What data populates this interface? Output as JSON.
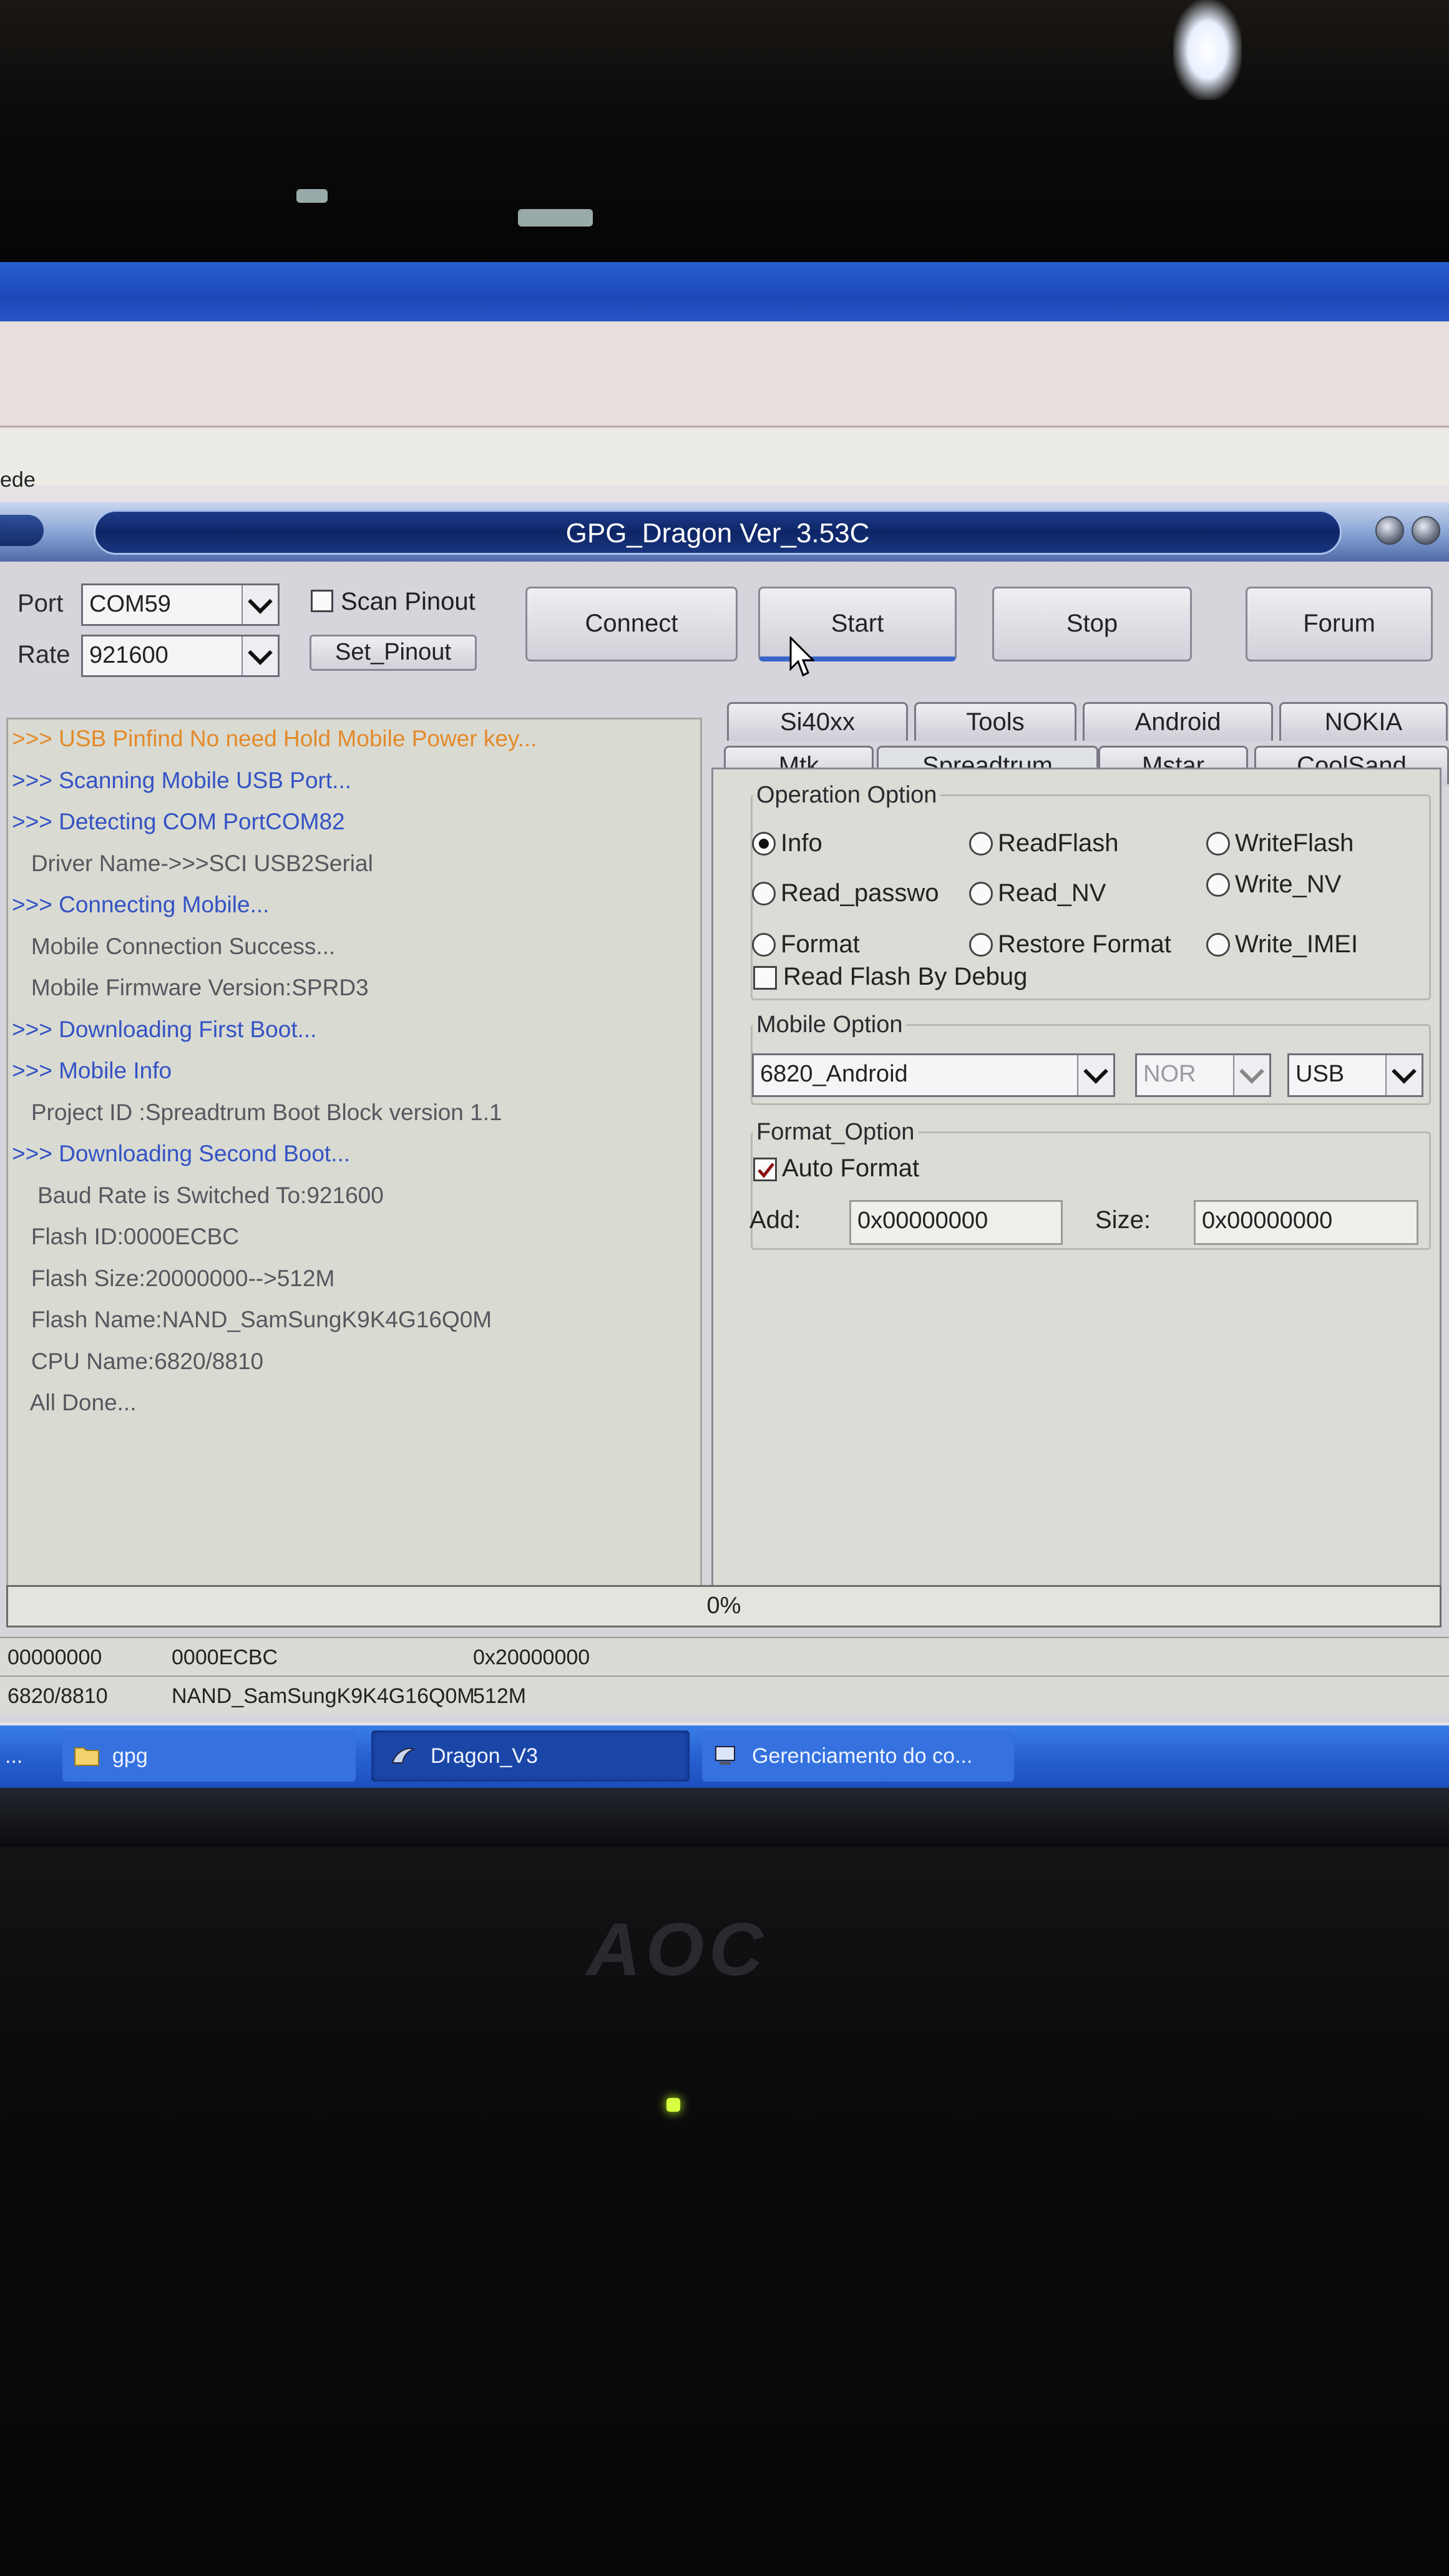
{
  "app": {
    "title": "GPG_Dragon  Ver_3.53C"
  },
  "background_window": {
    "label": "ede"
  },
  "connection": {
    "port_label": "Port",
    "port_value": "COM59",
    "rate_label": "Rate",
    "rate_value": "921600",
    "scan_pinout_label": "Scan Pinout",
    "set_pinout_label": "Set_Pinout"
  },
  "actions": {
    "connect": "Connect",
    "start": "Start",
    "stop": "Stop",
    "forum": "Forum"
  },
  "log": [
    {
      "text": ">>> USB Pinfind No need Hold Mobile Power key...",
      "color": "orange"
    },
    {
      "text": ">>> Scanning Mobile USB Port...",
      "color": "blue"
    },
    {
      "text": ">>> Detecting COM PortCOM82",
      "color": "blue"
    },
    {
      "text": "   Driver Name->>>SCI USB2Serial",
      "color": "gray"
    },
    {
      "text": ">>> Connecting Mobile...",
      "color": "blue"
    },
    {
      "text": "   Mobile Connection Success...",
      "color": "gray"
    },
    {
      "text": "   Mobile Firmware Version:SPRD3",
      "color": "gray"
    },
    {
      "text": ">>> Downloading First Boot...",
      "color": "blue"
    },
    {
      "text": ">>> Mobile Info",
      "color": "blue"
    },
    {
      "text": "   Project ID :Spreadtrum Boot Block version 1.1",
      "color": "gray"
    },
    {
      "text": ">>> Downloading Second Boot...",
      "color": "blue"
    },
    {
      "text": "    Baud Rate is Switched To:921600",
      "color": "gray"
    },
    {
      "text": "   Flash ID:0000ECBC",
      "color": "gray"
    },
    {
      "text": "   Flash Size:20000000-->512M",
      "color": "gray"
    },
    {
      "text": "   Flash Name:NAND_SamSungK9K4G16Q0M",
      "color": "gray"
    },
    {
      "text": "   CPU Name:6820/8810",
      "color": "gray"
    },
    {
      "text": "   All Done...",
      "color": "gray"
    }
  ],
  "tabs": {
    "row1": [
      "Si40xx",
      "Tools",
      "Android",
      "NOKIA"
    ],
    "row2": [
      "Mtk",
      "Spreadtrum",
      "Mstar",
      "CoolSand"
    ],
    "active": "Spreadtrum"
  },
  "operation_option": {
    "title": "Operation Option",
    "options": [
      "Info",
      "ReadFlash",
      "WriteFlash",
      "Read_passwo",
      "Read_NV",
      "Write_NV",
      "Format",
      "Restore Format",
      "Write_IMEI"
    ],
    "selected": "Info",
    "read_flash_by_debug": "Read Flash By Debug"
  },
  "mobile_option": {
    "title": "Mobile Option",
    "model": "6820_Android",
    "flash_type": "NOR",
    "interface": "USB"
  },
  "format_option": {
    "title": "Format_Option",
    "auto_format_label": "Auto Format",
    "auto_format_checked": true,
    "add_label": "Add:",
    "add_value": "0x00000000",
    "size_label": "Size:",
    "size_value": "0x00000000"
  },
  "progress": {
    "text": "0%",
    "value": 0
  },
  "status": {
    "row1": [
      "00000000",
      "0000ECBC",
      "0x20000000"
    ],
    "row2": [
      "6820/8810",
      "NAND_SamSungK9K4G16Q0M",
      "512M"
    ]
  },
  "taskbar": {
    "items": [
      "...",
      "gpg",
      "Dragon_V3",
      "Gerenciamento do co..."
    ]
  },
  "monitor": {
    "brand": "AOC"
  },
  "colors": {
    "log_orange": "#e38a2a",
    "log_blue": "#3452c4",
    "log_gray": "#55575e",
    "title_bar": "#0e2566",
    "taskbar": "#2761d2"
  }
}
